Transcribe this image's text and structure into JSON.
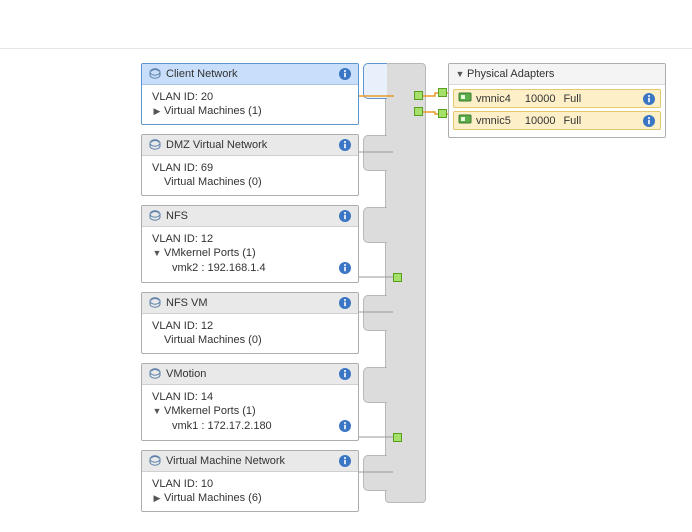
{
  "portgroups": [
    {
      "name": "Client Network",
      "vlan_label": "VLAN ID: 20",
      "rows": [
        {
          "kind": "expander",
          "label": "Virtual Machines (1)",
          "state": "collapsed"
        }
      ],
      "selected": true
    },
    {
      "name": "DMZ Virtual Network",
      "vlan_label": "VLAN ID: 69",
      "rows": [
        {
          "kind": "text",
          "label": "Virtual Machines (0)"
        }
      ],
      "selected": false
    },
    {
      "name": "NFS",
      "vlan_label": "VLAN ID: 12",
      "rows": [
        {
          "kind": "expander",
          "label": "VMkernel Ports (1)",
          "state": "expanded"
        },
        {
          "kind": "vmk",
          "label": "vmk2 : 192.168.1.4"
        }
      ],
      "selected": false
    },
    {
      "name": "NFS VM",
      "vlan_label": "VLAN ID: 12",
      "rows": [
        {
          "kind": "text",
          "label": "Virtual Machines (0)"
        }
      ],
      "selected": false
    },
    {
      "name": "VMotion",
      "vlan_label": "VLAN ID: 14",
      "rows": [
        {
          "kind": "expander",
          "label": "VMkernel Ports (1)",
          "state": "expanded"
        },
        {
          "kind": "vmk",
          "label": "vmk1 : 172.17.2.180"
        }
      ],
      "selected": false
    },
    {
      "name": "Virtual Machine Network",
      "vlan_label": "VLAN ID: 10",
      "rows": [
        {
          "kind": "expander",
          "label": "Virtual Machines (6)",
          "state": "collapsed"
        }
      ],
      "selected": false
    }
  ],
  "physical_adapters": {
    "title": "Physical Adapters",
    "nics": [
      {
        "name": "vmnic4",
        "speed": "10000",
        "duplex": "Full"
      },
      {
        "name": "vmnic5",
        "speed": "10000",
        "duplex": "Full"
      }
    ]
  },
  "colors": {
    "link_orange": "#e99a2a",
    "link_gray": "#9a9a9a",
    "selected_border": "#5f95cf"
  }
}
